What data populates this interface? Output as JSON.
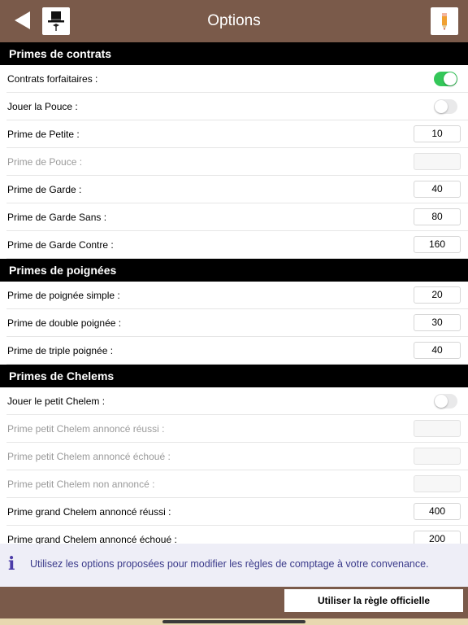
{
  "header": {
    "title": "Options",
    "back_icon": "back-arrow-icon",
    "hat_icon": "top-hat-icon",
    "edit_icon": "pencil-icon"
  },
  "sections": [
    {
      "title": "Primes de contrats",
      "rows": [
        {
          "label": "Contrats forfaitaires :",
          "control": "toggle",
          "on": true,
          "enabled": true
        },
        {
          "label": "Jouer la Pouce :",
          "control": "toggle",
          "on": false,
          "enabled": true
        },
        {
          "label": "Prime de Petite :",
          "control": "field",
          "value": "10",
          "enabled": true
        },
        {
          "label": "Prime de Pouce :",
          "control": "field",
          "value": "",
          "enabled": false
        },
        {
          "label": "Prime de Garde :",
          "control": "field",
          "value": "40",
          "enabled": true
        },
        {
          "label": "Prime de Garde Sans :",
          "control": "field",
          "value": "80",
          "enabled": true
        },
        {
          "label": "Prime de Garde Contre :",
          "control": "field",
          "value": "160",
          "enabled": true
        }
      ]
    },
    {
      "title": "Primes de poignées",
      "rows": [
        {
          "label": "Prime de poignée simple :",
          "control": "field",
          "value": "20",
          "enabled": true
        },
        {
          "label": "Prime de double poignée :",
          "control": "field",
          "value": "30",
          "enabled": true
        },
        {
          "label": "Prime de triple poignée :",
          "control": "field",
          "value": "40",
          "enabled": true
        }
      ]
    },
    {
      "title": "Primes de Chelems",
      "rows": [
        {
          "label": "Jouer le petit Chelem :",
          "control": "toggle",
          "on": false,
          "enabled": true
        },
        {
          "label": "Prime petit Chelem annoncé réussi :",
          "control": "field",
          "value": "",
          "enabled": false
        },
        {
          "label": "Prime petit Chelem annoncé échoué :",
          "control": "field",
          "value": "",
          "enabled": false
        },
        {
          "label": "Prime petit Chelem non annoncé :",
          "control": "field",
          "value": "",
          "enabled": false
        },
        {
          "label": "Prime grand Chelem annoncé réussi :",
          "control": "field",
          "value": "400",
          "enabled": true
        },
        {
          "label": "Prime grand Chelem annoncé échoué :",
          "control": "field",
          "value": "200",
          "enabled": true
        }
      ]
    }
  ],
  "info": {
    "icon": "info-icon",
    "text": "Utilisez les options proposées pour modifier les règles de comptage à votre convenance."
  },
  "footer": {
    "official_label": "Utiliser la règle officielle"
  },
  "colors": {
    "bar": "#7a5a4a",
    "toggle_on": "#34c759",
    "info_bg": "#eeeef7",
    "info_text": "#3a3a8a"
  }
}
